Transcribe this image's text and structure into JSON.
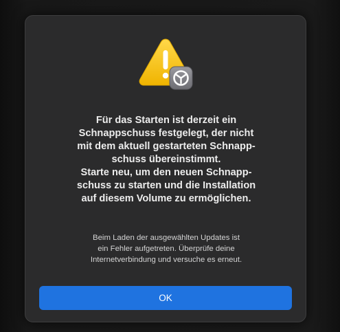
{
  "alert": {
    "icon": "warning-triangle-with-settings-badge-icon",
    "headline_lines": [
      "Für das Starten ist derzeit ein",
      "Schnappschuss festgelegt, der nicht",
      "mit dem aktuell gestarteten Schnapp-",
      "schuss übereinstimmt.",
      "Starte neu, um den neuen Schnapp-",
      "schuss zu starten und die Installation",
      "auf diesem Volume zu ermöglichen."
    ],
    "detail_lines": [
      "Beim Laden der ausgewählten Updates ist",
      "ein Fehler aufgetreten. Überprüfe deine",
      "Internetverbindung und versuche es erneut."
    ],
    "ok_label": "OK"
  },
  "colors": {
    "dialog_background": "#2b2b2c",
    "accent_button": "#1f73e0",
    "warning_yellow": "#f5c21b"
  }
}
